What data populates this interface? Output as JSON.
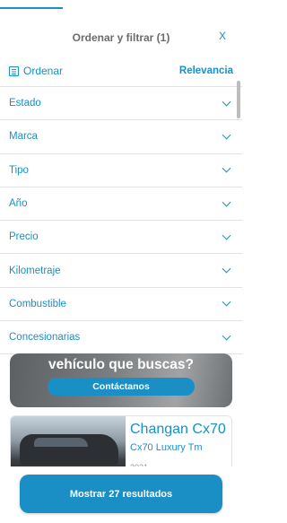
{
  "header": {
    "title": "Ordenar y filtrar (1)",
    "close_label": "X"
  },
  "sort": {
    "label": "Ordenar",
    "value": "Relevancia",
    "icon": "sort-list-icon"
  },
  "filters": [
    {
      "label": "Estado"
    },
    {
      "label": "Marca"
    },
    {
      "label": "Tipo"
    },
    {
      "label": "Año"
    },
    {
      "label": "Precio"
    },
    {
      "label": "Kilometraje"
    },
    {
      "label": "Combustible"
    },
    {
      "label": "Concesionarias"
    }
  ],
  "banner": {
    "text": "vehículo que buscas?",
    "button_label": "Contáctanos"
  },
  "listing": {
    "title": "Changan Cx70",
    "subtitle": "Cx70 Luxury Tm",
    "year": "2021"
  },
  "footer": {
    "button_label": "Mostrar 27 resultados"
  },
  "colors": {
    "accent": "#1a8fc6",
    "text_muted": "#6b6b6b",
    "divider": "#e3e3e3"
  }
}
